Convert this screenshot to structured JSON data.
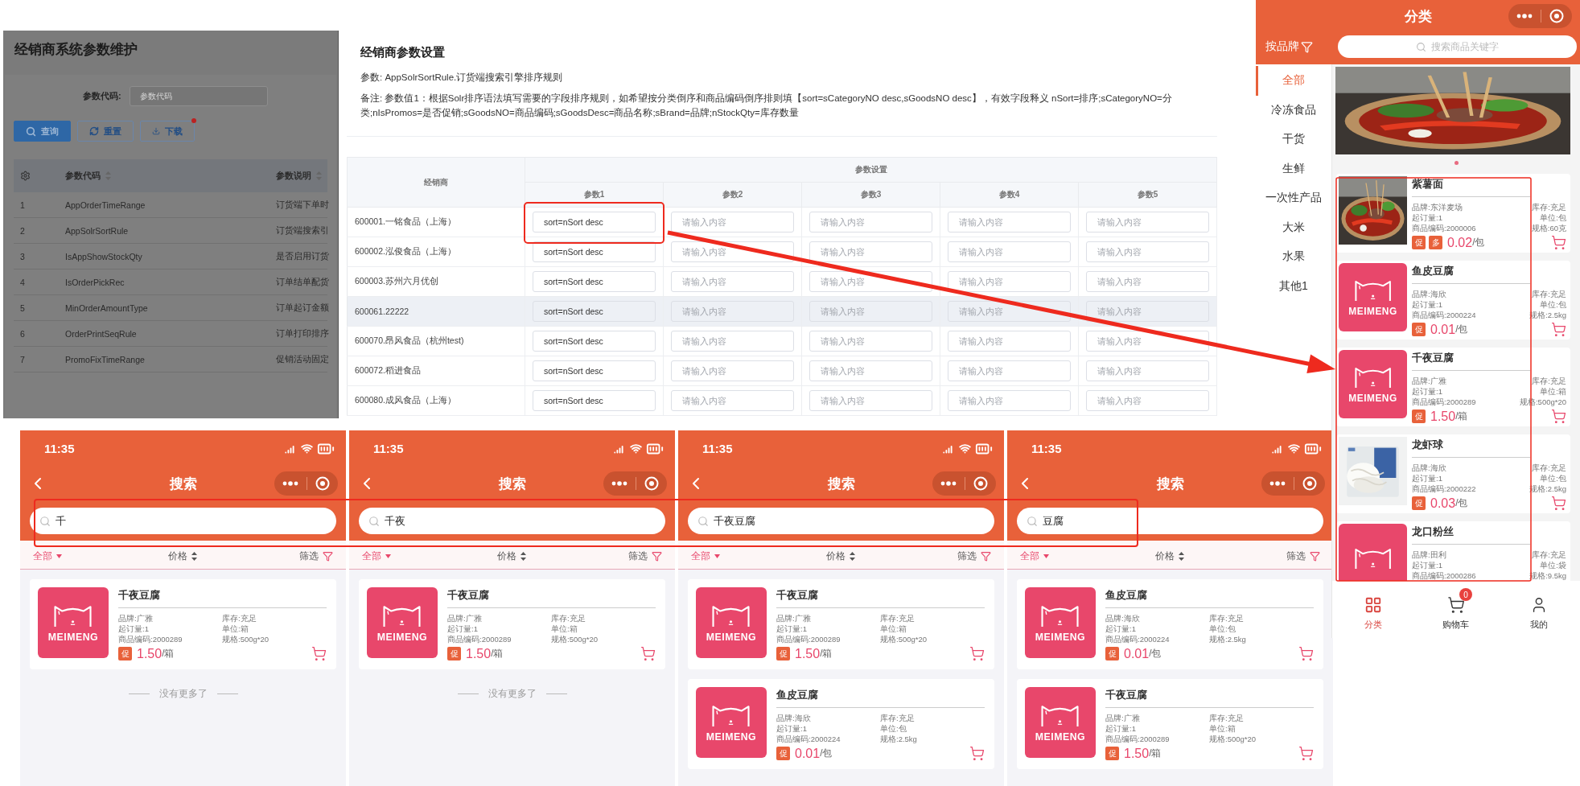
{
  "admin_panel": {
    "title": "经销商系统参数维护",
    "filter": {
      "label": "参数代码:",
      "placeholder": "参数代码"
    },
    "buttons": [
      {
        "label": "查询",
        "kind": "search",
        "notification": false
      },
      {
        "label": "重置",
        "kind": "reset",
        "notification": false
      },
      {
        "label": "下载",
        "kind": "download",
        "notification": true
      }
    ],
    "table": {
      "columns": [
        "参数代码",
        "参数说明"
      ],
      "rows": [
        {
          "index": "1",
          "code": "AppOrderTimeRange",
          "description": "订货端下单时"
        },
        {
          "index": "2",
          "code": "AppSolrSortRule",
          "description": "订货端搜索引"
        },
        {
          "index": "3",
          "code": "IsAppShowStockQty",
          "description": "是否启用订货"
        },
        {
          "index": "4",
          "code": "IsOrderPickRec",
          "description": "订单结单配货"
        },
        {
          "index": "5",
          "code": "MinOrderAmountType",
          "description": "订单起订金额"
        },
        {
          "index": "6",
          "code": "OrderPrintSeqRule",
          "description": "订单打印排序"
        },
        {
          "index": "7",
          "code": "PromoFixTimeRange",
          "description": "促销活动固定"
        }
      ]
    }
  },
  "params_dialog": {
    "title": "经销商参数设置",
    "param": "参数: AppSolrSortRule.订货端搜索引擎排序规则",
    "note": "备注: 参数值1：根据Solr排序语法填写需要的字段排序规则，如希望按分类倒序和商品编码倒序排则填【sort=sCategoryNO desc,sGoodsNO desc】，有效字段释义 nSort=排序;sCategoryNO=分类;nIsPromos=是否促销;sGoodsNO=商品编码;sGoodsDesc=商品名称;sBrand=品牌;nStockQty=库存数量",
    "table": {
      "dealer_header": "经销商",
      "group_header": "参数设置",
      "param_headers": [
        "参数1",
        "参数2",
        "参数3",
        "参数4",
        "参数5"
      ],
      "rows": [
        {
          "dealer": "600001.一铭食品（上海）",
          "highlighted": false,
          "values": [
            {
              "value": "sort=nSort desc"
            },
            {
              "placeholder": "请输入内容"
            },
            {
              "placeholder": "请输入内容"
            },
            {
              "placeholder": "请输入内容"
            },
            {
              "placeholder": "请输入内容"
            }
          ]
        },
        {
          "dealer": "600002.泓俊食品（上海）",
          "highlighted": false,
          "values": [
            {
              "value": "sort=nSort desc"
            },
            {
              "placeholder": "请输入内容"
            },
            {
              "placeholder": "请输入内容"
            },
            {
              "placeholder": "请输入内容"
            },
            {
              "placeholder": "请输入内容"
            }
          ]
        },
        {
          "dealer": "600003.苏州六月优创",
          "highlighted": false,
          "values": [
            {
              "value": "sort=nSort desc"
            },
            {
              "placeholder": "请输入内容"
            },
            {
              "placeholder": "请输入内容"
            },
            {
              "placeholder": "请输入内容"
            },
            {
              "placeholder": "请输入内容"
            }
          ]
        },
        {
          "dealer": "600061.22222",
          "highlighted": true,
          "values": [
            {
              "value": "sort=nSort desc"
            },
            {
              "placeholder": "请输入内容"
            },
            {
              "placeholder": "请输入内容"
            },
            {
              "placeholder": "请输入内容"
            },
            {
              "placeholder": "请输入内容"
            }
          ]
        },
        {
          "dealer": "600070.昂风食品（杭州test)",
          "highlighted": false,
          "values": [
            {
              "value": "sort=nSort desc"
            },
            {
              "placeholder": "请输入内容"
            },
            {
              "placeholder": "请输入内容"
            },
            {
              "placeholder": "请输入内容"
            },
            {
              "placeholder": "请输入内容"
            }
          ]
        },
        {
          "dealer": "600072.稻进食品",
          "highlighted": false,
          "values": [
            {
              "value": "sort=nSort desc"
            },
            {
              "placeholder": "请输入内容"
            },
            {
              "placeholder": "请输入内容"
            },
            {
              "placeholder": "请输入内容"
            },
            {
              "placeholder": "请输入内容"
            }
          ]
        },
        {
          "dealer": "600080.成风食品（上海）",
          "highlighted": false,
          "values": [
            {
              "value": "sort=nSort desc"
            },
            {
              "placeholder": "请输入内容"
            },
            {
              "placeholder": "请输入内容"
            },
            {
              "placeholder": "请输入内容"
            },
            {
              "placeholder": "请输入内容"
            }
          ]
        }
      ]
    }
  },
  "search_phones": [
    {
      "time": "11:35",
      "title": "搜索",
      "query": "千",
      "filters": [
        {
          "label": "全部",
          "kind": "dropdown",
          "selected": true
        },
        {
          "label": "价格",
          "kind": "sort",
          "selected": false
        },
        {
          "label": "筛选",
          "kind": "filter",
          "selected": false
        }
      ],
      "products": [
        {
          "name": "千夜豆腐",
          "image": {
            "kind": "logo",
            "text": "MEIMENG"
          },
          "details": [
            "品牌:广雅",
            "起订量:1",
            "商品编码:2000289"
          ],
          "details_right": [
            "库存:充足",
            "单位:箱",
            "规格:500g*20"
          ],
          "tags": [
            "促"
          ],
          "price": "1.50",
          "per": "/箱"
        }
      ],
      "end_text": "没有更多了"
    },
    {
      "time": "11:35",
      "title": "搜索",
      "query": "千夜",
      "filters": [
        {
          "label": "全部",
          "kind": "dropdown",
          "selected": true
        },
        {
          "label": "价格",
          "kind": "sort",
          "selected": false
        },
        {
          "label": "筛选",
          "kind": "filter",
          "selected": false
        }
      ],
      "products": [
        {
          "name": "千夜豆腐",
          "image": {
            "kind": "logo",
            "text": "MEIMENG"
          },
          "details": [
            "品牌:广雅",
            "起订量:1",
            "商品编码:2000289"
          ],
          "details_right": [
            "库存:充足",
            "单位:箱",
            "规格:500g*20"
          ],
          "tags": [
            "促"
          ],
          "price": "1.50",
          "per": "/箱"
        }
      ],
      "end_text": "没有更多了"
    },
    {
      "time": "11:35",
      "title": "搜索",
      "query": "千夜豆腐",
      "filters": [
        {
          "label": "全部",
          "kind": "dropdown",
          "selected": true
        },
        {
          "label": "价格",
          "kind": "sort",
          "selected": false
        },
        {
          "label": "筛选",
          "kind": "filter",
          "selected": false
        }
      ],
      "products": [
        {
          "name": "千夜豆腐",
          "image": {
            "kind": "logo",
            "text": "MEIMENG"
          },
          "details": [
            "品牌:广雅",
            "起订量:1",
            "商品编码:2000289"
          ],
          "details_right": [
            "库存:充足",
            "单位:箱",
            "规格:500g*20"
          ],
          "tags": [
            "促"
          ],
          "price": "1.50",
          "per": "/箱"
        },
        {
          "name": "鱼皮豆腐",
          "image": {
            "kind": "logo",
            "text": "MEIMENG"
          },
          "details": [
            "品牌:海欣",
            "起订量:1",
            "商品编码:2000224"
          ],
          "details_right": [
            "库存:充足",
            "单位:包",
            "规格:2.5kg"
          ],
          "tags": [
            "促"
          ],
          "price": "0.01",
          "per": "/包"
        }
      ]
    },
    {
      "time": "11:35",
      "title": "搜索",
      "query": "豆腐",
      "filters": [
        {
          "label": "全部",
          "kind": "dropdown",
          "selected": true
        },
        {
          "label": "价格",
          "kind": "sort",
          "selected": false
        },
        {
          "label": "筛选",
          "kind": "filter",
          "selected": false
        }
      ],
      "products": [
        {
          "name": "鱼皮豆腐",
          "image": {
            "kind": "logo",
            "text": "MEIMENG"
          },
          "details": [
            "品牌:海欣",
            "起订量:1",
            "商品编码:2000224"
          ],
          "details_right": [
            "库存:充足",
            "单位:包",
            "规格:2.5kg"
          ],
          "tags": [
            "促"
          ],
          "price": "0.01",
          "per": "/包"
        },
        {
          "name": "千夜豆腐",
          "image": {
            "kind": "logo",
            "text": "MEIMENG"
          },
          "details": [
            "品牌:广雅",
            "起订量:1",
            "商品编码:2000289"
          ],
          "details_right": [
            "库存:充足",
            "单位:箱",
            "规格:500g*20"
          ],
          "tags": [
            "促"
          ],
          "price": "1.50",
          "per": "/箱"
        }
      ]
    }
  ],
  "category_phone": {
    "title": "分类",
    "brand_filter": "按品牌",
    "search_placeholder": "搜索商品关键字",
    "categories": [
      {
        "label": "全部",
        "selected": true
      },
      {
        "label": "冷冻食品",
        "selected": false
      },
      {
        "label": "干货",
        "selected": false
      },
      {
        "label": "生鲜",
        "selected": false
      },
      {
        "label": "一次性产品",
        "selected": false
      },
      {
        "label": "大米",
        "selected": false
      },
      {
        "label": "水果",
        "selected": false
      },
      {
        "label": "其他1",
        "selected": false
      }
    ],
    "banner": {
      "kind": "picture"
    },
    "products": [
      {
        "name": "紫薯面",
        "image": {
          "kind": "picture"
        },
        "details": [
          "品牌:东洋麦场",
          "起订量:1",
          "商品编码:2000006"
        ],
        "details_right": [
          "库存:充足",
          "单位:包",
          "规格:60克"
        ],
        "tags": [
          "促",
          "多"
        ],
        "price": "0.02",
        "per": "/包"
      },
      {
        "name": "鱼皮豆腐",
        "image": {
          "kind": "logo",
          "text": "MEIMENG"
        },
        "details": [
          "品牌:海欣",
          "起订量:1",
          "商品编码:2000224"
        ],
        "details_right": [
          "库存:充足",
          "单位:包",
          "规格:2.5kg"
        ],
        "tags": [
          "促"
        ],
        "price": "0.01",
        "per": "/包"
      },
      {
        "name": "千夜豆腐",
        "image": {
          "kind": "logo",
          "text": "MEIMENG"
        },
        "details": [
          "品牌:广雅",
          "起订量:1",
          "商品编码:2000289"
        ],
        "details_right": [
          "库存:充足",
          "单位:箱",
          "规格:500g*20"
        ],
        "tags": [
          "促"
        ],
        "price": "1.50",
        "per": "/箱"
      },
      {
        "name": "龙虾球",
        "image": {
          "kind": "picture"
        },
        "details": [
          "品牌:海欣",
          "起订量:1",
          "商品编码:2000222"
        ],
        "details_right": [
          "库存:充足",
          "单位:包",
          "规格:2.5kg"
        ],
        "tags": [
          "促"
        ],
        "price": "0.03",
        "per": "/包"
      },
      {
        "name": "龙口粉丝",
        "image": {
          "kind": "logo"
        },
        "details": [
          "品牌:田利",
          "起订量:1",
          "商品编码:2000286"
        ],
        "details_right": [
          "库存:充足",
          "单位:袋",
          "规格:9.5kg"
        ]
      }
    ],
    "tabbar": [
      {
        "label": "分类",
        "kind": "grid",
        "selected": true
      },
      {
        "label": "购物车",
        "kind": "cart",
        "selected": false,
        "badge": "0"
      },
      {
        "label": "我的",
        "kind": "user",
        "selected": false
      }
    ]
  }
}
